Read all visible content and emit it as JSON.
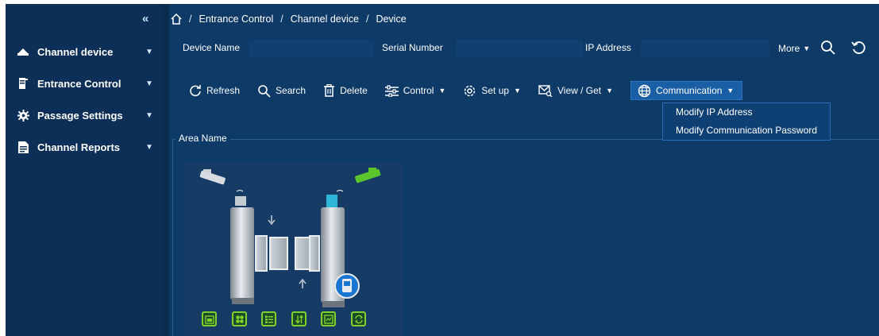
{
  "sidebar": {
    "collapse_icon": "double-chevron-left-icon",
    "items": [
      {
        "label": "Channel device",
        "icon": "barrier-icon"
      },
      {
        "label": "Entrance Control",
        "icon": "turnstile-icon"
      },
      {
        "label": "Passage Settings",
        "icon": "gear-icon"
      },
      {
        "label": "Channel Reports",
        "icon": "document-icon"
      }
    ]
  },
  "breadcrumb": {
    "home_icon": "home-icon",
    "separator": "/",
    "items": [
      "Entrance Control",
      "Channel device",
      "Device"
    ]
  },
  "filters": {
    "device_name_label": "Device Name",
    "device_name_value": "",
    "serial_number_label": "Serial Number",
    "serial_number_value": "",
    "ip_address_label": "IP Address",
    "ip_address_value": "",
    "more_label": "More"
  },
  "toolbar": {
    "refresh": "Refresh",
    "search": "Search",
    "delete": "Delete",
    "control": "Control",
    "setup": "Set up",
    "view_get": "View / Get",
    "communication": "Communication"
  },
  "communication_menu": {
    "items": [
      "Modify IP Address",
      "Modify Communication Password"
    ]
  },
  "area": {
    "label": "Area Name"
  },
  "device_card": {
    "functions": [
      "door-icon",
      "grid-icon",
      "list-icon",
      "sort-icon",
      "report-icon",
      "sync-icon"
    ]
  },
  "colors": {
    "background": "#0e3a68",
    "sidebar": "#0b2f57",
    "accent": "#1a5ea6",
    "function_green": "#7fd12c",
    "camera_green": "#5cc52c"
  }
}
